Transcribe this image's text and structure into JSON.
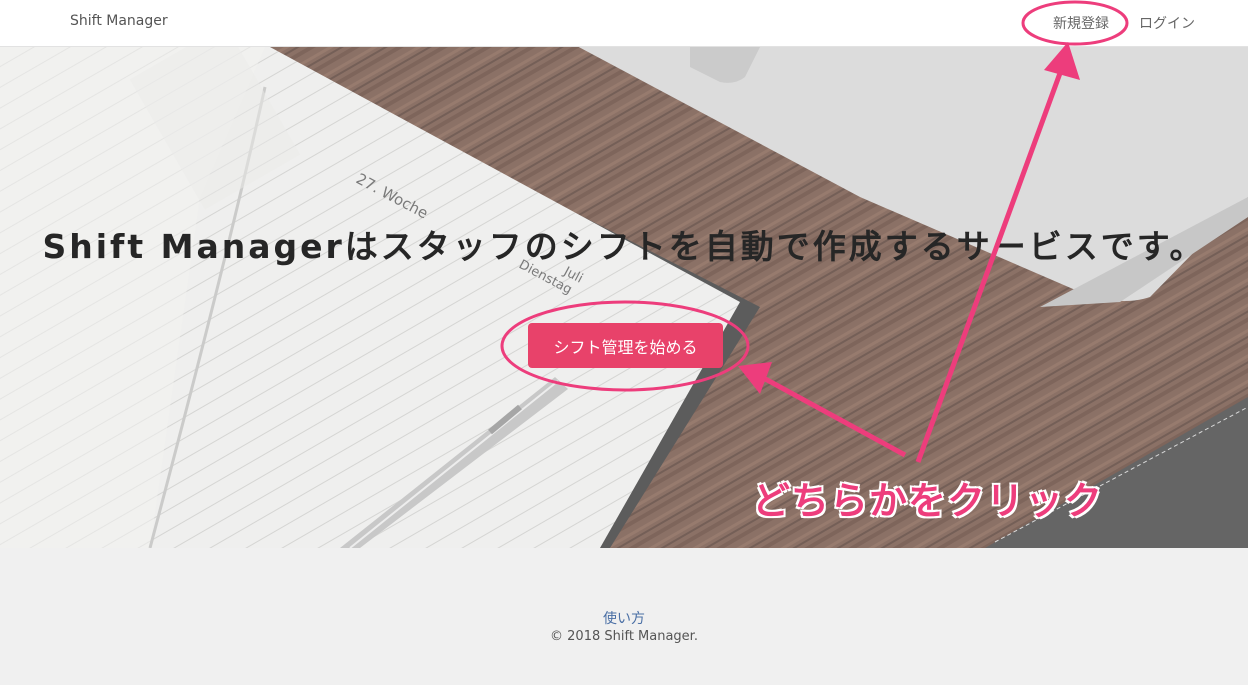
{
  "navbar": {
    "brand": "Shift Manager",
    "signup_label": "新規登録",
    "login_label": "ログイン"
  },
  "hero": {
    "title": "Shift Managerはスタッフのシフトを自動で作成するサービスです。",
    "cta_label": "シフト管理を始める",
    "background": {
      "notebook_text": [
        "27. Woche",
        "Juli",
        "Dienstag"
      ]
    }
  },
  "annotation": {
    "callout": "どちらかをクリック",
    "color": "#ed3d7c"
  },
  "footer": {
    "link_label": "使い方",
    "copyright": "© 2018 Shift Manager."
  },
  "colors": {
    "accent": "#e8426a",
    "annotation": "#ed3d7c",
    "footer_bg": "#f0f0f0",
    "link": "#4a6fa5"
  }
}
